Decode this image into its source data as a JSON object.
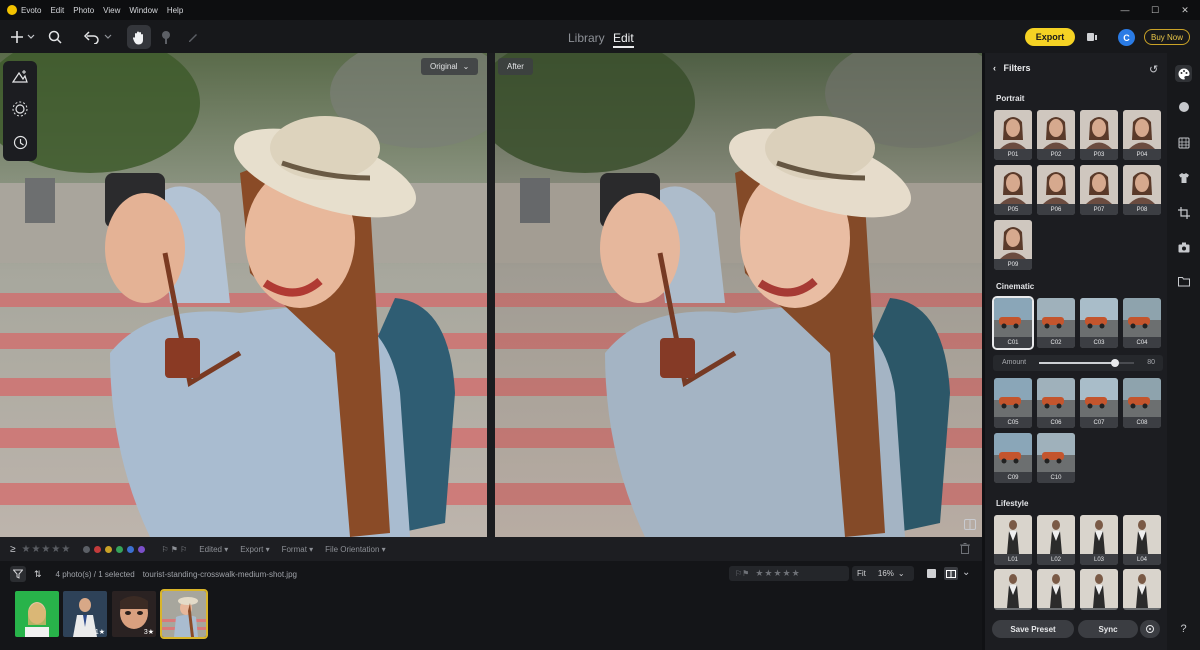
{
  "app": {
    "name": "Evoto"
  },
  "menu": [
    "Evoto",
    "Edit",
    "Photo",
    "View",
    "Window",
    "Help"
  ],
  "window_controls": [
    "—",
    "☐",
    "✕"
  ],
  "toolbar": {
    "tabs": [
      {
        "label": "Library",
        "active": false
      },
      {
        "label": "Edit",
        "active": true
      }
    ],
    "export_label": "Export",
    "avatar_letter": "C",
    "buynow_label": "Buy Now",
    "add_icon": "plus-icon",
    "search_icon": "search-icon",
    "undo_icon": "undo-icon",
    "hand_icon": "hand-icon"
  },
  "canvas": {
    "original_label": "Original",
    "after_label": "After"
  },
  "statusbar": {
    "rating_glyph": "≥",
    "stars": "★★★★★",
    "colors": [
      "#5b5f66",
      "#c23b3b",
      "#c9a227",
      "#35a35a",
      "#3b6fd0",
      "#7b4fc9"
    ],
    "flags": "⚐ ⚑ ⚐",
    "edited": "Edited ▾",
    "export": "Export ▾",
    "format": "Format ▾",
    "orientation": "File Orientation ▾"
  },
  "filmhead": {
    "count_text": "4 photo(s) / 1 selected",
    "filename": "tourist-standing-crosswalk-medium-shot.jpg",
    "stars": "★★★★★",
    "fit_label": "Fit",
    "zoom": "16%"
  },
  "thumbnails": [
    {
      "name": "green-screen",
      "badge": "",
      "selected": false
    },
    {
      "name": "man-suit",
      "badge": "1★",
      "selected": false
    },
    {
      "name": "woman-closeup",
      "badge": "3★",
      "selected": false
    },
    {
      "name": "tourist-crosswalk",
      "badge": "",
      "selected": true
    }
  ],
  "panel": {
    "title": "Filters",
    "sections": [
      {
        "title": "Portrait",
        "presets": [
          "P01",
          "P02",
          "P03",
          "P04",
          "P05",
          "P06",
          "P07",
          "P08",
          "P09"
        ]
      },
      {
        "title": "Cinematic",
        "presets": [
          "C01",
          "C02",
          "C03",
          "C04",
          "C05",
          "C06",
          "C07",
          "C08",
          "C09",
          "C10"
        ]
      },
      {
        "title": "Lifestyle",
        "presets": [
          "L01",
          "L02",
          "L03",
          "L04",
          "",
          "",
          "",
          ""
        ]
      }
    ],
    "amount_label": "Amount",
    "amount_value": "80",
    "amount_fraction": 0.8,
    "save_preset": "Save Preset",
    "sync": "Sync"
  },
  "rail_icons": [
    "palette-icon",
    "face-icon",
    "layers-icon",
    "shirt-icon",
    "crop-icon",
    "camera-icon",
    "folder-icon",
    "help-icon"
  ]
}
